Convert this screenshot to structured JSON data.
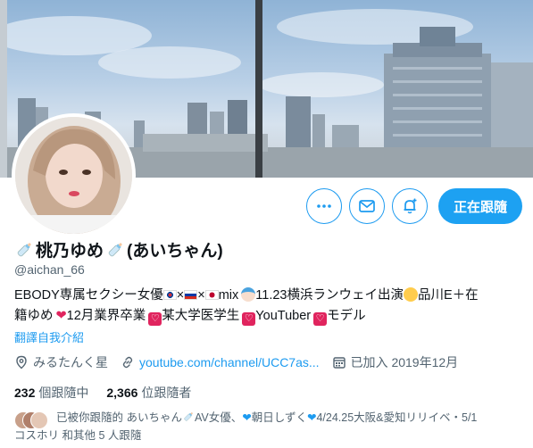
{
  "profile": {
    "name": "桃乃ゆめ",
    "name_suffix": "(あいちゃん)",
    "handle": "@aichan_66",
    "follow_label": "正在跟隨"
  },
  "bio": {
    "line1_a": "EBODY専属セクシー女優",
    "line1_b": "×",
    "line1_c": "×",
    "line1_d": "mix",
    "line1_e": "11.23横浜ランウェイ出演",
    "line1_f": "品川E＋在",
    "line2_a": "籍ゆめ",
    "line2_b": "12月業界卒業",
    "line2_c": "某大学医学生",
    "line2_d": "YouTuber",
    "line2_e": "モデル"
  },
  "translate_label": "翻譯自我介紹",
  "meta": {
    "location": "みるたんく星",
    "link": "youtube.com/channel/UCC7as...",
    "joined": "已加入 2019年12月"
  },
  "stats": {
    "following_count": "232",
    "following_label": "個跟隨中",
    "followers_count": "2,366",
    "followers_label": "位跟隨者"
  },
  "followed_by": {
    "prefix": "已被你跟隨的 あいちゃん",
    "p1": "AV女優、",
    "p2": "朝日しずく",
    "p3": "4/24.25大阪&愛知リリイベ・5/1",
    "p4": "コスホリ 和其他 5 人跟隨"
  },
  "icons": {
    "more": "more-icon",
    "message": "message-icon",
    "notify": "bell-plus-icon",
    "location": "location-pin-icon",
    "link": "link-icon",
    "calendar": "calendar-icon"
  },
  "colors": {
    "accent": "#1d9bf0",
    "follow_button": "#1da1f2",
    "muted": "#536471",
    "heart": "#e0245e"
  }
}
